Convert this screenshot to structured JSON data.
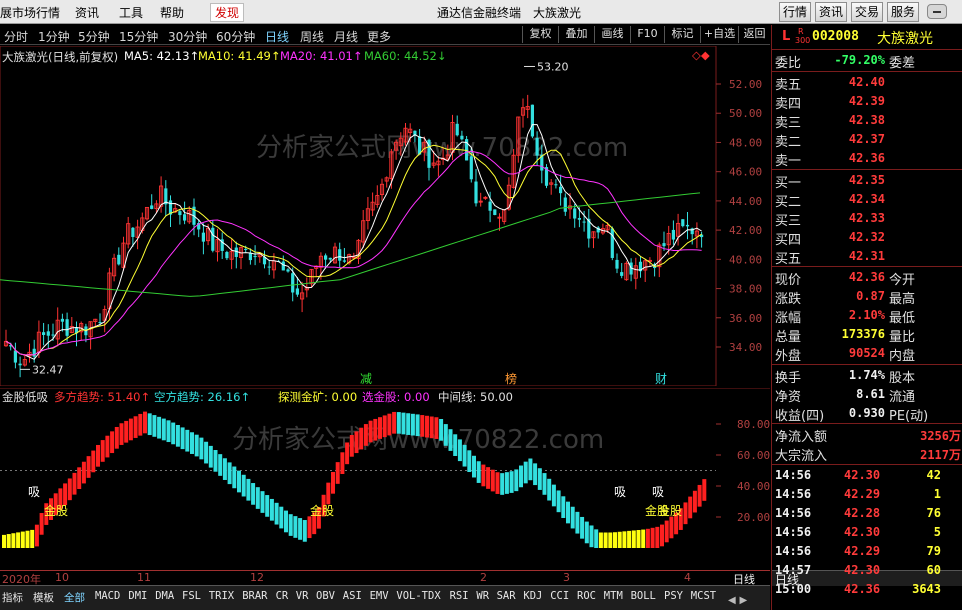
{
  "menubar": {
    "items": [
      "展市场行情",
      "资讯",
      "工具",
      "帮助",
      "发现"
    ],
    "title_left": "通达信金融终端",
    "title_right": "大族激光",
    "buttons": [
      "行情",
      "资讯",
      "交易",
      "服务"
    ]
  },
  "toolbar": {
    "periods": [
      "分时",
      "1分钟",
      "5分钟",
      "15分钟",
      "30分钟",
      "60分钟",
      "日线",
      "周线",
      "月线",
      "更多"
    ],
    "active_period": "日线",
    "tools": [
      "复权",
      "叠加",
      "画线",
      "F10",
      "标记",
      "+自选",
      "返回"
    ],
    "diamond_icons": "◇◆"
  },
  "main_chart": {
    "legend_name": "大族激光(日线,前复权)",
    "ma5": "MA5: 42.13↑",
    "ma10": "MA10: 41.49↑",
    "ma20": "MA20: 41.01↑",
    "ma60": "MA60: 44.52↓",
    "max_label": "53.20",
    "min_label": "32.47",
    "watermark": "分析家公式网www.70822.com",
    "markers": [
      "减",
      "榜",
      "财"
    ]
  },
  "indicator": {
    "name": "金股低吸",
    "duo": "多方趋势: 51.40↑",
    "kong": "空方趋势: 26.16↑",
    "tance": "探测金矿: 0.00",
    "xuan": "选金股: 0.00",
    "zhong": "中间线: 50.00",
    "signals": {
      "xi": "吸",
      "jingu": "金股"
    },
    "watermark": "分析家公式网www.70822.com"
  },
  "date_axis": {
    "ticks": [
      "2020年",
      "10",
      "11",
      "12",
      "2",
      "3",
      "4"
    ],
    "right_label": "日线"
  },
  "tabs": {
    "items": [
      "指标",
      "模板",
      "全部",
      "MACD",
      "DMI",
      "DMA",
      "FSL",
      "TRIX",
      "BRAR",
      "CR",
      "VR",
      "OBV",
      "ASI",
      "EMV",
      "VOL-TDX",
      "RSI",
      "WR",
      "SAR",
      "KDJ",
      "CCI",
      "ROC",
      "MTM",
      "BOLL",
      "PSY",
      "MCST"
    ],
    "active": "全部"
  },
  "quote": {
    "badge": "L",
    "badge_r": "R",
    "badge_300": "300",
    "code": "002008",
    "name": "大族激光",
    "weibi_label": "委比",
    "weibi": "-79.20%",
    "weicha_label": "委差",
    "sell": [
      {
        "label": "卖五",
        "price": "42.40"
      },
      {
        "label": "卖四",
        "price": "42.39"
      },
      {
        "label": "卖三",
        "price": "42.38"
      },
      {
        "label": "卖二",
        "price": "42.37"
      },
      {
        "label": "卖一",
        "price": "42.36"
      }
    ],
    "buy": [
      {
        "label": "买一",
        "price": "42.35"
      },
      {
        "label": "买二",
        "price": "42.34"
      },
      {
        "label": "买三",
        "price": "42.33"
      },
      {
        "label": "买四",
        "price": "42.32"
      },
      {
        "label": "买五",
        "price": "42.31"
      }
    ],
    "stats": [
      {
        "label": "现价",
        "value": "42.36",
        "label2": "今开",
        "color": "red"
      },
      {
        "label": "涨跌",
        "value": "0.87",
        "label2": "最高",
        "color": "red"
      },
      {
        "label": "涨幅",
        "value": "2.10%",
        "label2": "最低",
        "color": "red"
      },
      {
        "label": "总量",
        "value": "173376",
        "label2": "量比",
        "color": "yellow"
      },
      {
        "label": "外盘",
        "value": "90524",
        "label2": "内盘",
        "color": "red"
      }
    ],
    "stats2": [
      {
        "label": "换手",
        "value": "1.74%",
        "label2": "股本",
        "color": "white"
      },
      {
        "label": "净资",
        "value": "8.61",
        "label2": "流通",
        "color": "white"
      },
      {
        "label": "收益(四)",
        "value": "0.930",
        "label2": "PE(动)",
        "color": "white"
      }
    ],
    "flow": [
      {
        "label": "净流入额",
        "value": "3256万"
      },
      {
        "label": "大宗流入",
        "value": "2117万"
      }
    ],
    "ticks": [
      {
        "time": "14:56",
        "price": "42.30",
        "vol": "42",
        "vcolor": "yellow"
      },
      {
        "time": "14:56",
        "price": "42.29",
        "vol": "1",
        "vcolor": "yellow"
      },
      {
        "time": "14:56",
        "price": "42.28",
        "vol": "76",
        "vcolor": "yellow"
      },
      {
        "time": "14:56",
        "price": "42.30",
        "vol": "5",
        "vcolor": "yellow"
      },
      {
        "time": "14:56",
        "price": "42.29",
        "vol": "79",
        "vcolor": "yellow"
      },
      {
        "time": "14:57",
        "price": "42.30",
        "vol": "60",
        "vcolor": "yellow"
      },
      {
        "time": "15:00",
        "price": "42.36",
        "vol": "3643",
        "vcolor": "magenta"
      }
    ],
    "bottom_label": "日线"
  },
  "price_axis": [
    "52.00",
    "50.00",
    "48.00",
    "46.00",
    "44.00",
    "42.00",
    "40.00",
    "38.00",
    "36.00",
    "34.00"
  ],
  "ind_axis": [
    "80.00",
    "60.00",
    "40.00",
    "20.00"
  ],
  "colors": {
    "up": "#ff3333",
    "down": "#33e0e0",
    "ma5": "#ffffff",
    "ma10": "#ffff33",
    "ma20": "#ff33ff",
    "ma60": "#33cc33"
  }
}
